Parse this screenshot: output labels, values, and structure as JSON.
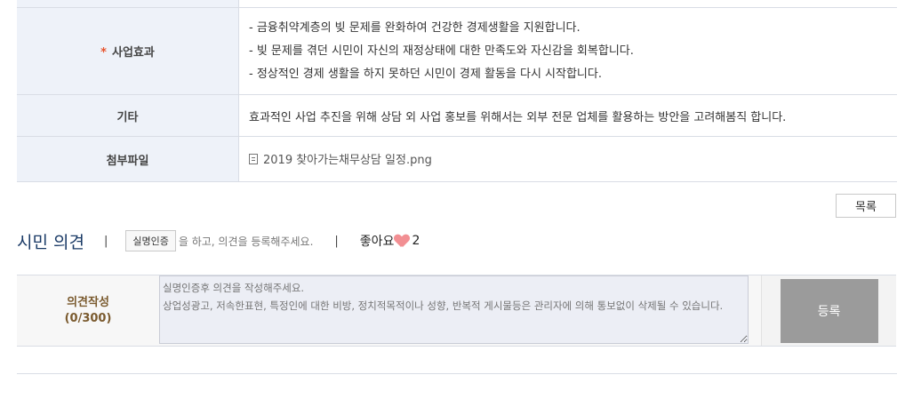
{
  "table": {
    "effect_label": "사업효과",
    "effect_required_mark": "*",
    "effect_lines": [
      "- 금융취약계층의 빚 문제를 완화하여 건강한 경제생활을 지원합니다.",
      "- 빚 문제를 겪던 시민이 자신의 재정상태에 대한 만족도와 자신감을 회복합니다.",
      "- 정상적인 경제 생활을 하지 못하던 시민이 경제 활동을 다시 시작합니다."
    ],
    "etc_label": "기타",
    "etc_value": "효과적인 사업 추진을 위해 상담 외 사업 홍보를 위해서는 외부 전문 업체를 활용하는 방안을 고려해봄직 합니다.",
    "attach_label": "첨부파일",
    "attach_file": "2019 찾아가는채무상담 일정.png"
  },
  "list_button": "목록",
  "opinion": {
    "title": "시민 의견",
    "separator": "|",
    "auth_button": "실명인증",
    "auth_text": "을 하고, 의견을 등록해주세요.",
    "like_label": "좋아요",
    "like_count": "2"
  },
  "comment": {
    "label": "의견작성",
    "counter": "(0/300)",
    "placeholder": "실명인증후 의견을 작성해주세요.\n상업성광고, 저속한표현, 특정인에 대한 비방, 정치적목적이나 성향, 반복적 게시물등은 관리자에 의해 통보없이 삭제될 수 있습니다.",
    "submit": "등록"
  }
}
